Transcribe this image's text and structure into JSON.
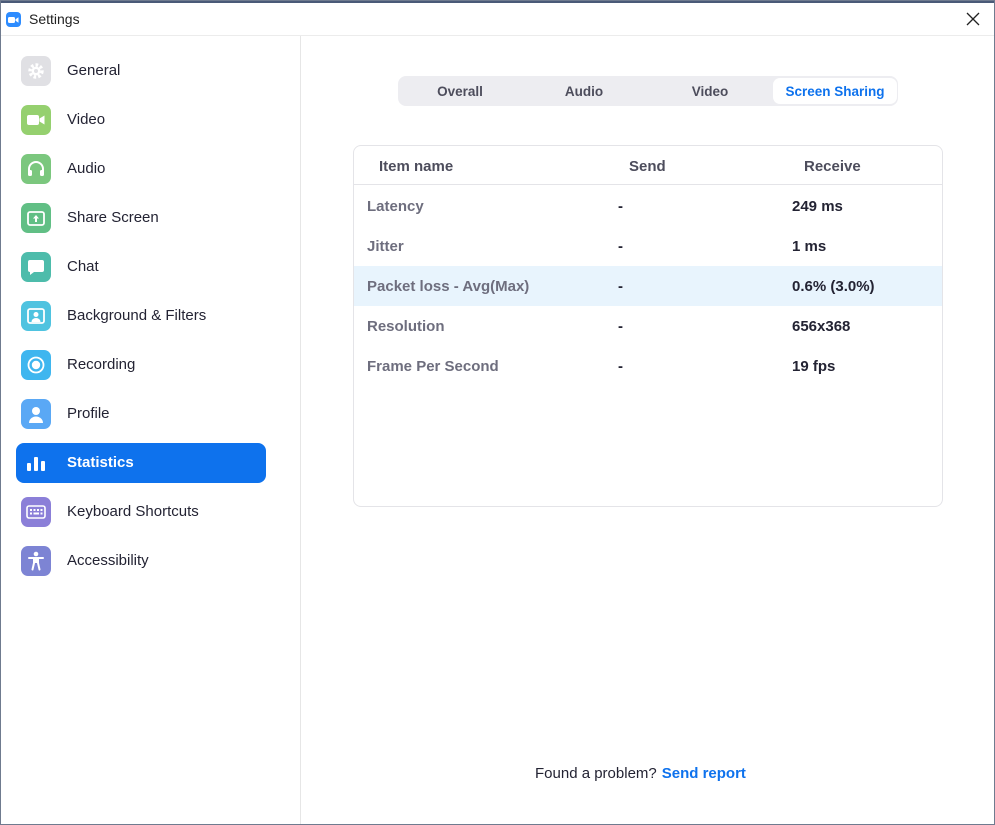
{
  "window": {
    "title": "Settings"
  },
  "sidebar": {
    "items": [
      {
        "label": "General",
        "icon": "gear-icon",
        "color": "#e0e0e4",
        "active": false
      },
      {
        "label": "Video",
        "icon": "video-camera-icon",
        "color": "#95d06f",
        "active": false
      },
      {
        "label": "Audio",
        "icon": "headphones-icon",
        "color": "#7bc77e",
        "active": false
      },
      {
        "label": "Share Screen",
        "icon": "share-screen-icon",
        "color": "#61bf85",
        "active": false
      },
      {
        "label": "Chat",
        "icon": "chat-bubble-icon",
        "color": "#4dbcab",
        "active": false
      },
      {
        "label": "Background & Filters",
        "icon": "background-person-icon",
        "color": "#4fc3e0",
        "active": false
      },
      {
        "label": "Recording",
        "icon": "record-icon",
        "color": "#3fb6ef",
        "active": false
      },
      {
        "label": "Profile",
        "icon": "person-icon",
        "color": "#5aa8f5",
        "active": false
      },
      {
        "label": "Statistics",
        "icon": "bar-chart-icon",
        "color": "#0e72ed",
        "active": true
      },
      {
        "label": "Keyboard Shortcuts",
        "icon": "keyboard-icon",
        "color": "#8b7fd8",
        "active": false
      },
      {
        "label": "Accessibility",
        "icon": "accessibility-icon",
        "color": "#7d84d4",
        "active": false
      }
    ]
  },
  "tabs": [
    {
      "label": "Overall",
      "active": false
    },
    {
      "label": "Audio",
      "active": false
    },
    {
      "label": "Video",
      "active": false
    },
    {
      "label": "Screen Sharing",
      "active": true
    }
  ],
  "stats": {
    "headers": {
      "name": "Item name",
      "send": "Send",
      "receive": "Receive"
    },
    "rows": [
      {
        "name": "Latency",
        "send": "-",
        "receive": "249 ms",
        "highlighted": false
      },
      {
        "name": "Jitter",
        "send": "-",
        "receive": "1 ms",
        "highlighted": false
      },
      {
        "name": "Packet loss - Avg(Max)",
        "send": "-",
        "receive": "0.6% (3.0%)",
        "highlighted": true
      },
      {
        "name": "Resolution",
        "send": "-",
        "receive": "656x368",
        "highlighted": false
      },
      {
        "name": "Frame Per Second",
        "send": "-",
        "receive": "19 fps",
        "highlighted": false
      }
    ]
  },
  "footer": {
    "prompt": "Found a problem?",
    "link": "Send report"
  },
  "colors": {
    "accent": "#0e72ed",
    "row_highlight": "#e8f4fd"
  }
}
